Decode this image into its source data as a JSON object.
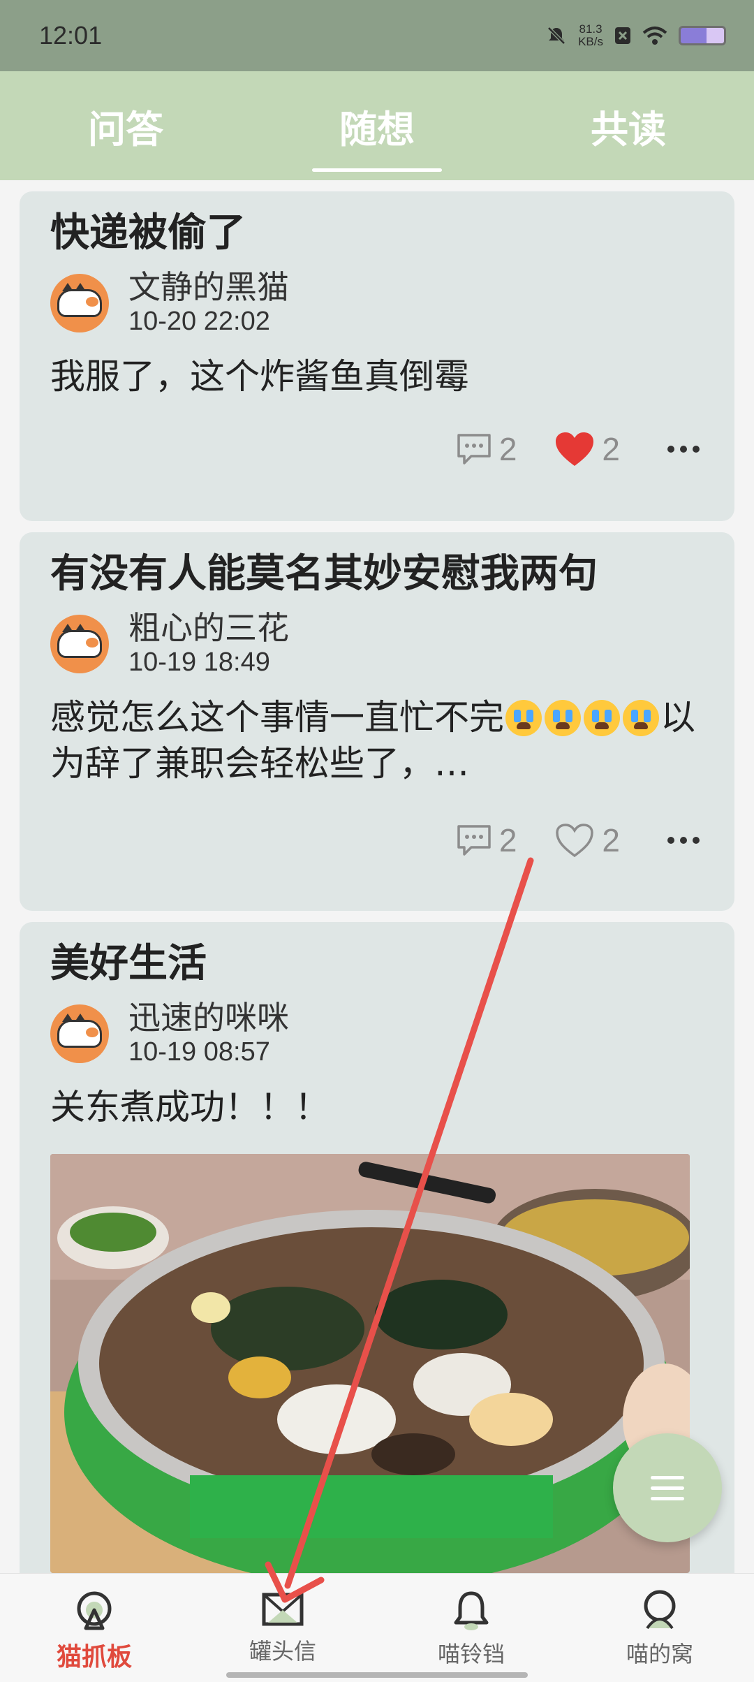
{
  "status_bar": {
    "time": "12:01",
    "netspeed_value": "81.3",
    "netspeed_unit": "KB/s",
    "icons": [
      "mute-icon",
      "sim-x-icon",
      "wifi-icon",
      "battery-icon"
    ]
  },
  "tabs": [
    {
      "label": "问答",
      "active": false
    },
    {
      "label": "随想",
      "active": true
    },
    {
      "label": "共读",
      "active": false
    }
  ],
  "posts": [
    {
      "title": "快递被偷了",
      "author": "文静的黑猫",
      "time": "10-20 22:02",
      "text": "我服了，这个炸酱鱼真倒霉",
      "comments": "2",
      "likes": "2",
      "liked": true
    },
    {
      "title": "有没有人能莫名其妙安慰我两句",
      "author": "粗心的三花",
      "time": "10-19 18:49",
      "text_a": "感觉怎么这个事情一直忙不完",
      "text_b": "以为辞了兼职会轻松些了，…",
      "emoji_count": 4,
      "comments": "2",
      "likes": "2",
      "liked": false
    },
    {
      "title": "美好生活",
      "author": "迅速的咪咪",
      "time": "10-19 08:57",
      "text": "关东煮成功！！！",
      "image": "oden-hotpot-photo"
    }
  ],
  "bottom_nav": [
    {
      "label": "猫抓板",
      "icon": "scratch-board-icon",
      "active": true
    },
    {
      "label": "罐头信",
      "icon": "envelope-icon",
      "active": false
    },
    {
      "label": "喵铃铛",
      "icon": "bell-icon",
      "active": false
    },
    {
      "label": "喵的窝",
      "icon": "cat-nest-icon",
      "active": false
    }
  ],
  "colors": {
    "header": "#c3d8b7",
    "status_bar": "#8c9f89",
    "card": "#dfe6e5",
    "accent_red": "#e04a3d",
    "heart_red": "#e53935",
    "annotation_arrow": "#e8504a"
  }
}
